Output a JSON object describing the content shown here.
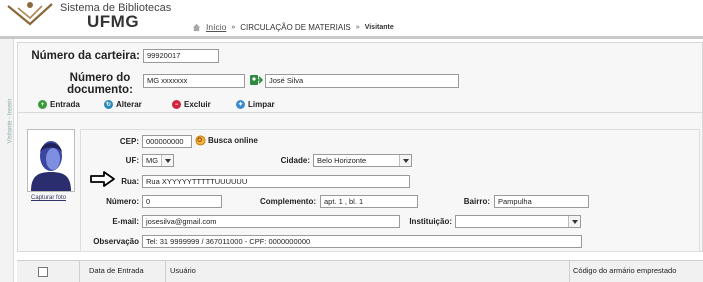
{
  "header": {
    "system_title": "Sistema de Bibliotecas",
    "system_sub": "UFMG",
    "breadcrumb": {
      "home": "Início",
      "items": [
        "CIRCULAÇÃO DE MATERIAIS",
        "Visitante"
      ]
    }
  },
  "side": {
    "label": "Visitante - Inserir"
  },
  "form": {
    "card_label": "Número da carteira:",
    "card_value": "99920017",
    "doc_label": "Número do documento:",
    "doc_value": "MG xxxxxxx",
    "doc_name_value": "José Silva"
  },
  "toolbar": {
    "entrada": "Entrada",
    "alterar": "Alterar",
    "excluir": "Excluir",
    "limpar": "Limpar"
  },
  "photo": {
    "capture_label": "Capturar foto"
  },
  "details": {
    "cep_label": "CEP:",
    "cep_value": "000000000",
    "busca_label": "Busca online",
    "uf_label": "UF:",
    "uf_value": "MG",
    "cidade_label": "Cidade:",
    "cidade_value": "Belo Horizonte",
    "rua_label": "Rua:",
    "rua_value": "Rua XYYYYYTTTTTUUUUUU",
    "numero_label": "Número:",
    "numero_value": "0",
    "complemento_label": "Complemento:",
    "complemento_value": "apt. 1 , bl. 1",
    "bairro_label": "Bairro:",
    "bairro_value": "Pampulha",
    "email_label": "E-mail:",
    "email_value": "josesilva@gmail.com",
    "instituicao_label": "Instituição:",
    "instituicao_value": "",
    "obs_label": "Observação",
    "obs_value": "Tel: 31 9999999 / 367011000 - CPF: 0000000000"
  },
  "table": {
    "columns": [
      "Data de Entrada",
      "Usuário",
      "Código do armário emprestado"
    ]
  },
  "colors": {
    "entrada_icon": "#3a9a3a",
    "alterar_icon": "#2a8ab8",
    "excluir_icon": "#d0243a",
    "limpar_icon": "#3a8ad0",
    "logo": "#8a6a3a"
  }
}
